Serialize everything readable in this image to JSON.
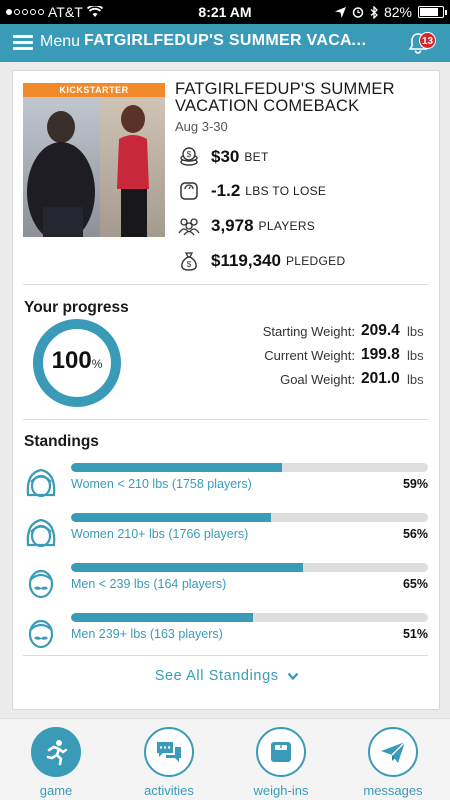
{
  "status_bar": {
    "carrier": "AT&T",
    "time": "8:21 AM",
    "battery": "82%",
    "battery_level": 0.82
  },
  "header": {
    "menu_label": "Menu",
    "title": "FATGIRLFEDUP'S SUMMER VACATION COMEBACK",
    "notification_count": "13"
  },
  "event": {
    "photo_banner": "KICKSTARTER",
    "title": "FATGIRLFEDUP'S SUMMER VACATION COMEBACK",
    "dates": "Aug 3-30",
    "stats": [
      {
        "icon": "coins-icon",
        "value": "$30",
        "unit": "BET"
      },
      {
        "icon": "scale-icon",
        "value": "-1.2",
        "unit": "LBS TO LOSE"
      },
      {
        "icon": "players-icon",
        "value": "3,978",
        "unit": "PLAYERS"
      },
      {
        "icon": "money-bag-icon",
        "value": "$119,340",
        "unit": "PLEDGED"
      }
    ]
  },
  "progress": {
    "title": "Your progress",
    "percent": "100",
    "percent_symbol": "%",
    "percent_value": 100,
    "weights": [
      {
        "label": "Starting Weight:",
        "value": "209.4",
        "unit": "lbs"
      },
      {
        "label": "Current Weight:",
        "value": "199.8",
        "unit": "lbs"
      },
      {
        "label": "Goal Weight:",
        "value": "201.0",
        "unit": "lbs"
      }
    ]
  },
  "standings": {
    "title": "Standings",
    "rows": [
      {
        "icon": "woman-face-icon",
        "label": "Women < 210 lbs (1758 players)",
        "percent": "59%",
        "value": 59
      },
      {
        "icon": "woman-face-icon",
        "label": "Women 210+ lbs (1766 players)",
        "percent": "56%",
        "value": 56
      },
      {
        "icon": "man-face-icon",
        "label": "Men < 239 lbs (164 players)",
        "percent": "65%",
        "value": 65
      },
      {
        "icon": "man-face-icon",
        "label": "Men 239+ lbs (163 players)",
        "percent": "51%",
        "value": 51
      }
    ],
    "see_all": "See All Standings"
  },
  "nav": {
    "items": [
      {
        "label": "game",
        "icon": "runner-icon",
        "active": true
      },
      {
        "label": "activities",
        "icon": "chat-bubbles-icon",
        "active": false
      },
      {
        "label": "weigh-ins",
        "icon": "scale-icon",
        "active": false
      },
      {
        "label": "messages",
        "icon": "paper-plane-icon",
        "active": false
      }
    ]
  },
  "colors": {
    "accent": "#3a9bb8",
    "badge": "#d6262c",
    "banner": "#f08a2a"
  }
}
